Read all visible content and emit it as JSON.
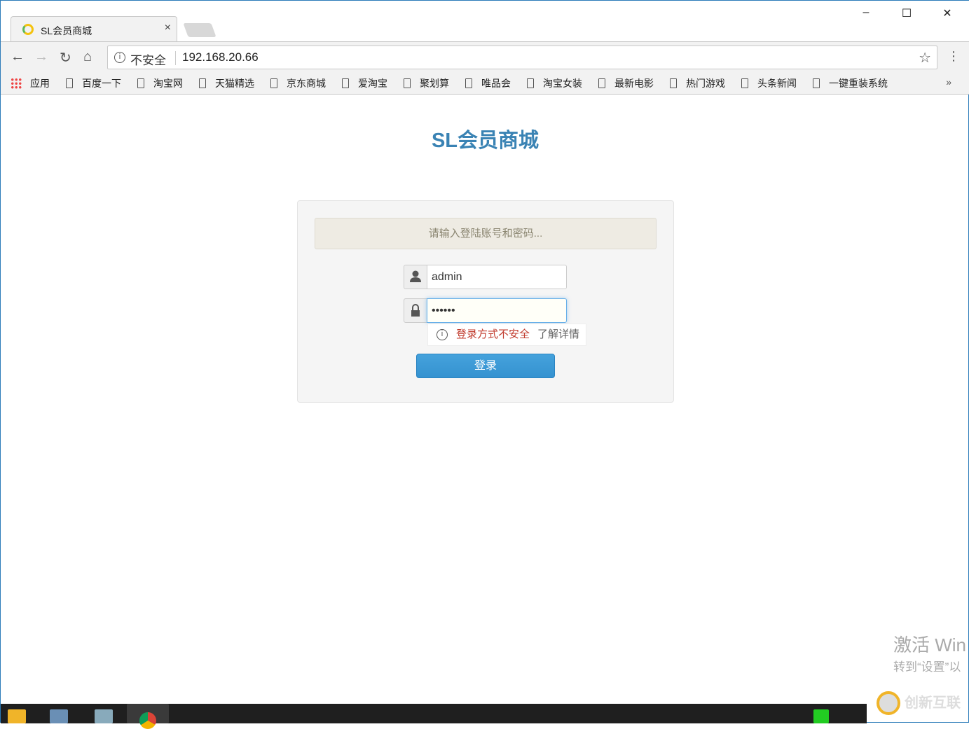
{
  "browser": {
    "tab_title": "SL会员商城",
    "insecure_label": "不安全",
    "url": "192.168.20.66",
    "window_controls": {
      "minimize": "–",
      "maximize": "☐",
      "close": "✕"
    },
    "bookmarks_apps": "应用",
    "bookmarks": [
      "百度一下",
      "淘宝网",
      "天猫精选",
      "京东商城",
      "爱淘宝",
      "聚划算",
      "唯品会",
      "淘宝女装",
      "最新电影",
      "热门游戏",
      "头条新闻",
      "一键重装系统"
    ],
    "more": "»"
  },
  "page": {
    "title": "SL会员商城",
    "alert": "请输入登陆账号和密码...",
    "username": "admin",
    "password": "••••••",
    "insecure_warning": "登录方式不安全",
    "learn_more": "了解详情",
    "login_button": "登录"
  },
  "overlay": {
    "activate_title": "激活 Win",
    "activate_sub": "转到“设置”以",
    "brand_watermark": "创新互联"
  },
  "colors": {
    "title": "#3a83b4",
    "button": "#3592d0",
    "warning": "#c0392b"
  }
}
